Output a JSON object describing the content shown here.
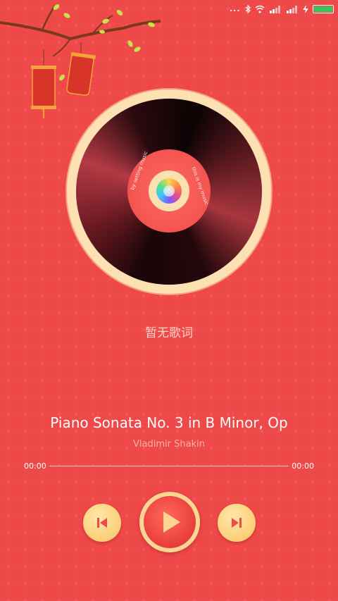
{
  "status_bar": {
    "dots": "...",
    "battery_level": 1.0,
    "battery_color": "#34c759"
  },
  "disc": {
    "label_left": "by setting music",
    "label_right": "this is my music"
  },
  "lyrics": {
    "placeholder": "暂无歌词"
  },
  "track": {
    "title": "Piano Sonata No. 3 in B Minor, Op",
    "artist": "Vladimir Shakin"
  },
  "progress": {
    "current": "00:00",
    "total": "00:00",
    "fraction": 0
  },
  "controls": {
    "prev_icon": "skip-previous-icon",
    "play_icon": "play-icon",
    "next_icon": "skip-next-icon"
  },
  "colors": {
    "background": "#ef4848",
    "button_gold": "#fbcf77",
    "play_red": "#e83a3a"
  }
}
